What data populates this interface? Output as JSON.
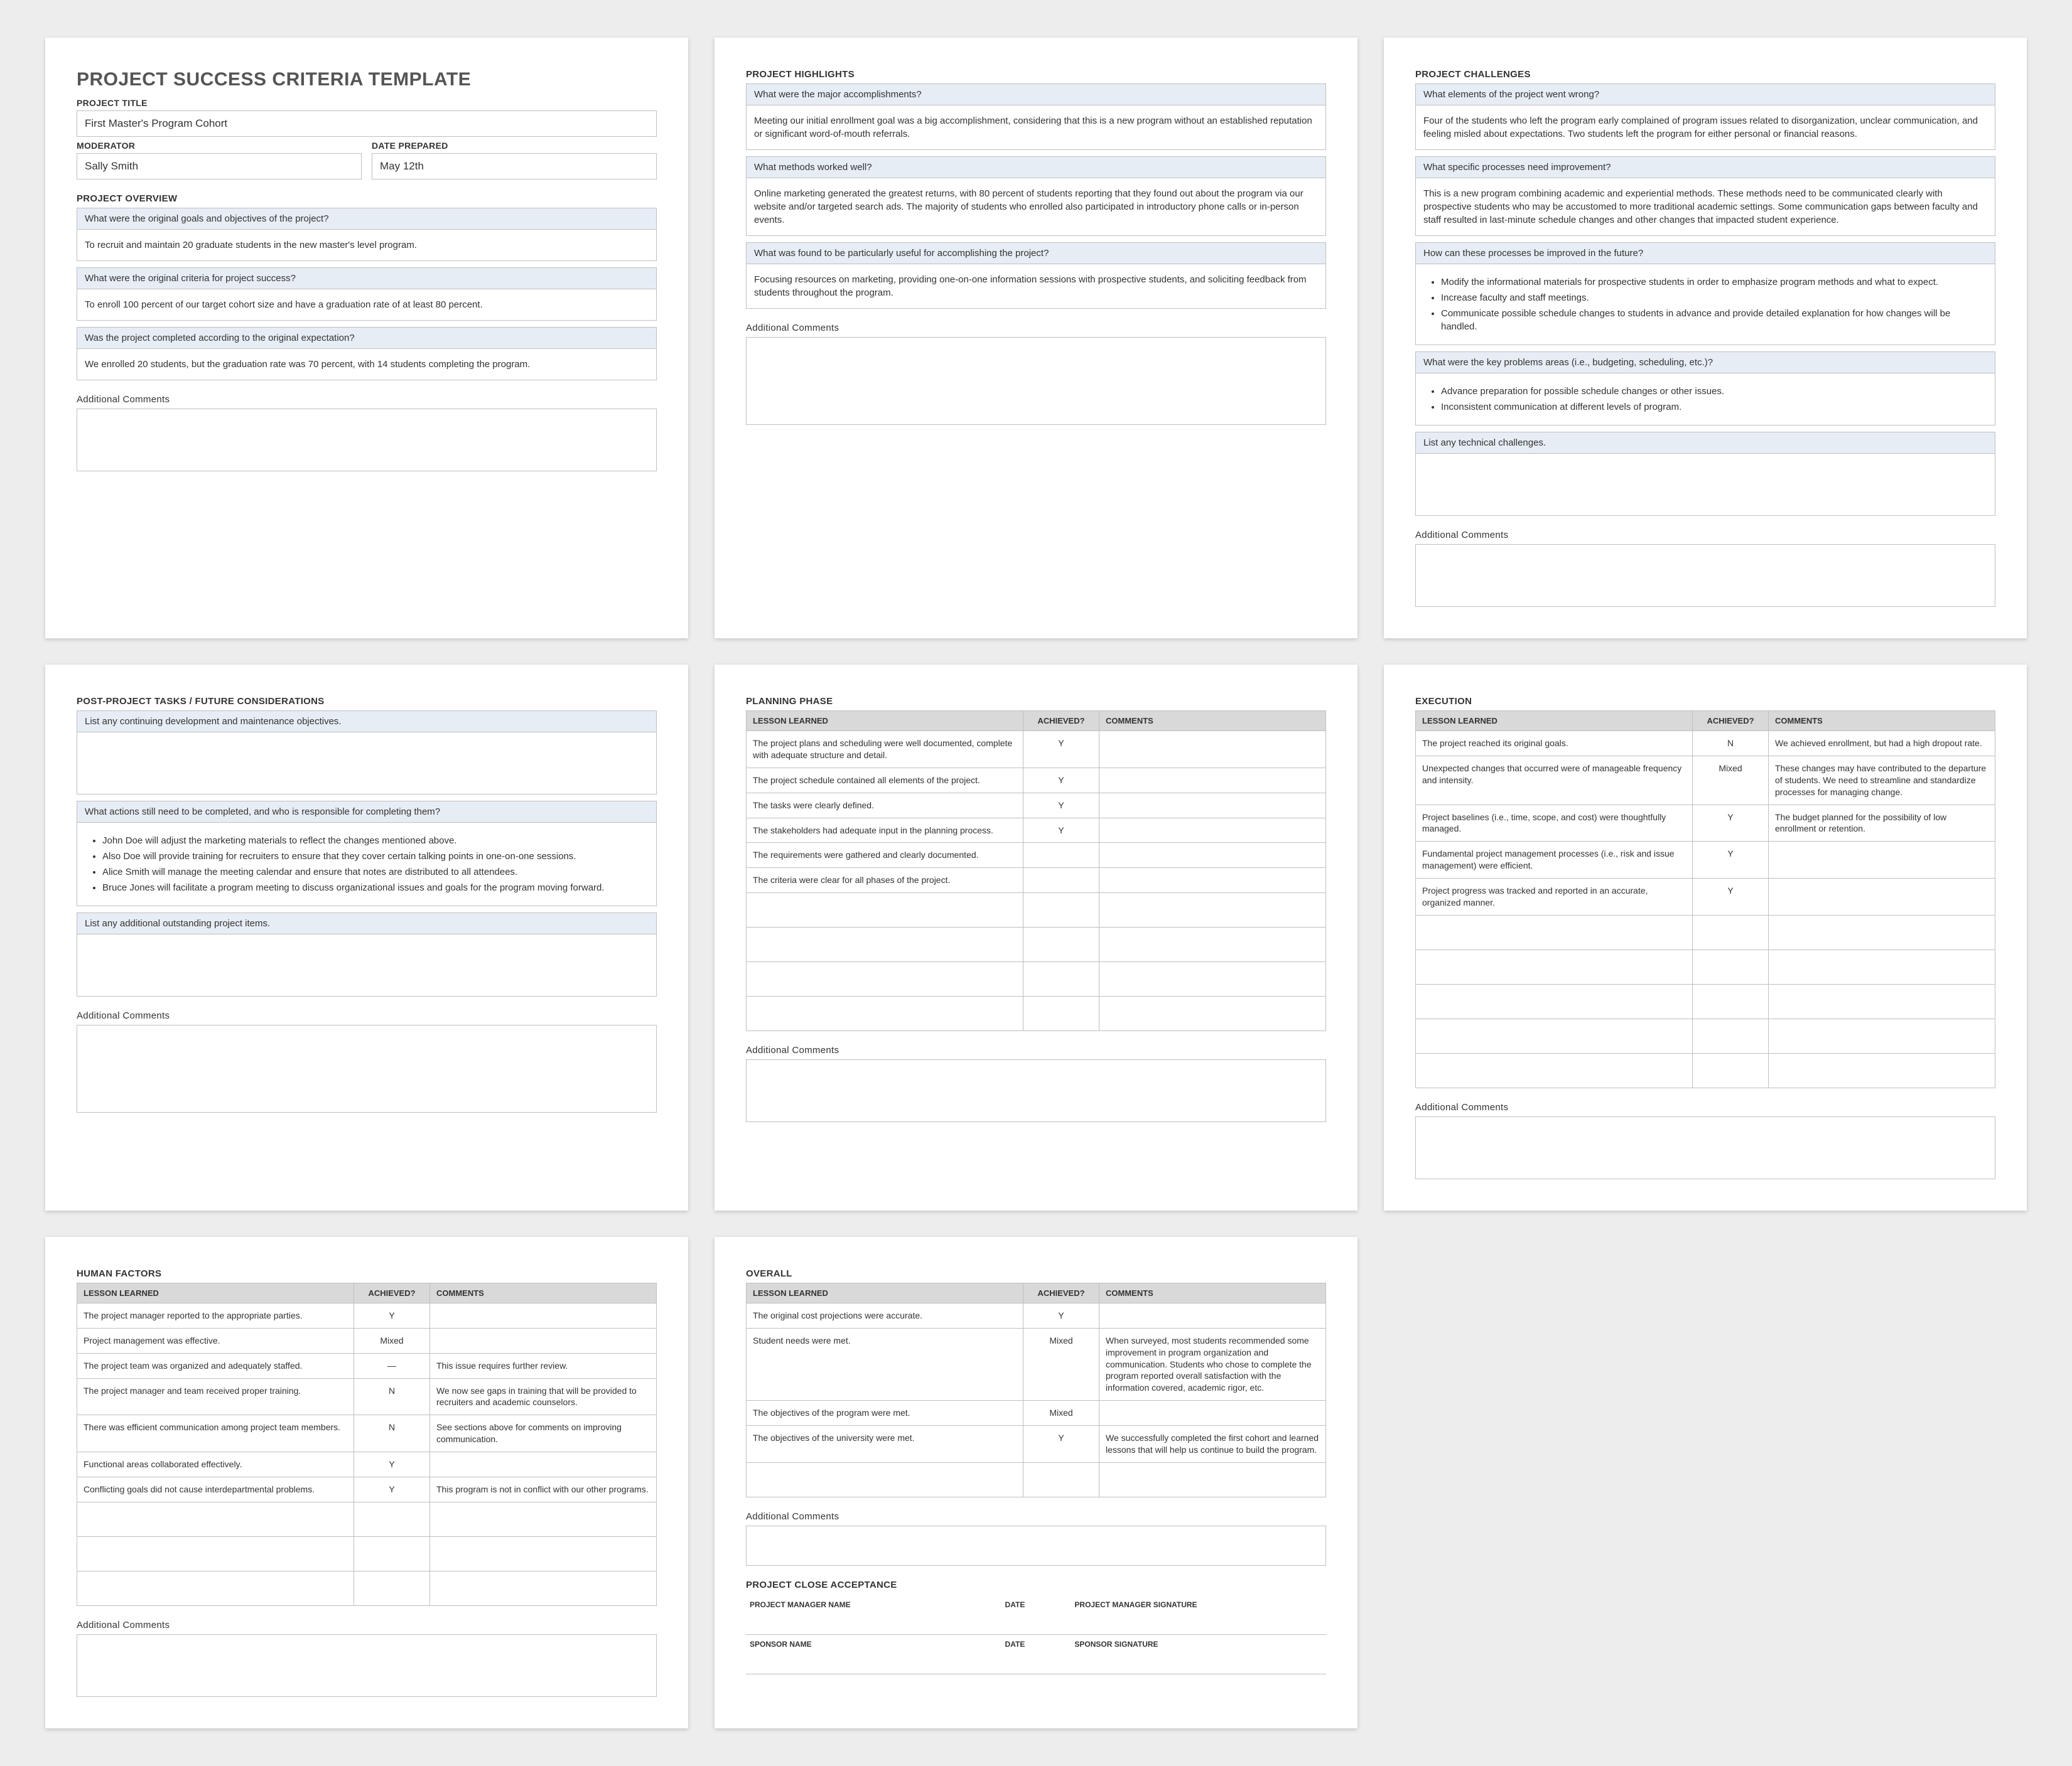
{
  "template_title": "PROJECT SUCCESS CRITERIA TEMPLATE",
  "labels": {
    "project_title": "PROJECT TITLE",
    "moderator": "MODERATOR",
    "date_prepared": "DATE PREPARED",
    "project_overview": "PROJECT OVERVIEW",
    "additional_comments": "Additional Comments",
    "project_highlights": "PROJECT HIGHLIGHTS",
    "project_challenges": "PROJECT CHALLENGES",
    "post_project": "POST-PROJECT TASKS / FUTURE CONSIDERATIONS",
    "planning_phase": "PLANNING PHASE",
    "execution": "EXECUTION",
    "human_factors": "HUMAN FACTORS",
    "overall": "OVERALL",
    "lesson_learned": "LESSON LEARNED",
    "achieved": "ACHIEVED?",
    "comments": "COMMENTS",
    "project_close": "PROJECT CLOSE ACCEPTANCE",
    "pm_name": "PROJECT MANAGER NAME",
    "date": "DATE",
    "pm_sig": "PROJECT MANAGER SIGNATURE",
    "sponsor_name": "SPONSOR NAME",
    "sponsor_sig": "SPONSOR SIGNATURE"
  },
  "header": {
    "project_title": "First Master's Program Cohort",
    "moderator": "Sally Smith",
    "date_prepared": "May 12th"
  },
  "overview": {
    "q1": "What were the original goals and objectives of the project?",
    "a1": "To recruit and maintain 20 graduate students in the new master's level program.",
    "q2": "What were the original criteria for project success?",
    "a2": "To enroll 100 percent of our target cohort size and have a graduation rate of at least 80 percent.",
    "q3": "Was the project completed according to the original expectation?",
    "a3": "We enrolled 20 students, but the graduation rate was 70 percent, with 14 students completing the program."
  },
  "highlights": {
    "q1": "What were the major accomplishments?",
    "a1": "Meeting our initial enrollment goal was a big accomplishment, considering that this is a new program without an established reputation or significant word-of-mouth referrals.",
    "q2": "What methods worked well?",
    "a2": "Online marketing generated the greatest returns, with 80 percent of students reporting that they found out about the program via our website and/or targeted search ads. The majority of students who enrolled also participated in introductory phone calls or in-person events.",
    "q3": "What was found to be particularly useful for accomplishing the project?",
    "a3": "Focusing resources on marketing, providing one-on-one information sessions with prospective students, and soliciting feedback from students throughout the program."
  },
  "challenges": {
    "q1": "What elements of the project went wrong?",
    "a1": "Four of the students who left the program early complained of program issues related to disorganization, unclear communication, and feeling misled about expectations. Two students left the program for either personal or financial reasons.",
    "q2": "What specific processes need improvement?",
    "a2": "This is a new program combining academic and experiential methods. These methods need to be communicated clearly with prospective students who may be accustomed to more traditional academic settings. Some communication gaps between faculty and staff resulted in last-minute schedule changes and other changes that impacted student experience.",
    "q3": "How can these processes be improved in the future?",
    "a3": [
      "Modify the informational materials for prospective students in order to emphasize program methods and what to expect.",
      "Increase faculty and staff meetings.",
      "Communicate possible schedule changes to students in advance and provide detailed explanation for how changes will be handled."
    ],
    "q4": "What were the key problems areas (i.e., budgeting, scheduling, etc.)?",
    "a4": [
      "Advance preparation for possible schedule changes or other issues.",
      "Inconsistent communication at different levels of program."
    ],
    "q5": "List any technical challenges."
  },
  "post_project": {
    "q1": "List any continuing development and maintenance objectives.",
    "q2": "What actions still need to be completed, and who is responsible for completing them?",
    "a2": [
      "John Doe will adjust the marketing materials to reflect the changes mentioned above.",
      "Also Doe will provide training for recruiters to ensure that they cover certain talking points in one-on-one sessions.",
      "Alice Smith will manage the meeting calendar and ensure that notes are distributed to all attendees.",
      "Bruce Jones will facilitate a program meeting to discuss organizational issues and goals for the program moving forward."
    ],
    "q3": "List any additional outstanding project items."
  },
  "planning": [
    {
      "l": "The project plans and scheduling were well documented, complete with adequate structure and detail.",
      "a": "Y",
      "c": ""
    },
    {
      "l": "The project schedule contained all elements of the project.",
      "a": "Y",
      "c": ""
    },
    {
      "l": "The tasks were clearly defined.",
      "a": "Y",
      "c": ""
    },
    {
      "l": "The stakeholders had adequate input in the planning process.",
      "a": "Y",
      "c": ""
    },
    {
      "l": "The requirements were gathered and clearly documented.",
      "a": "",
      "c": ""
    },
    {
      "l": "The criteria were clear for all phases of the project.",
      "a": "",
      "c": ""
    }
  ],
  "execution": [
    {
      "l": "The project reached its original goals.",
      "a": "N",
      "c": "We achieved enrollment, but had a high dropout rate."
    },
    {
      "l": "Unexpected changes that occurred were of manageable frequency and intensity.",
      "a": "Mixed",
      "c": "These changes may have contributed to the departure of students. We need to streamline and standardize processes for managing change."
    },
    {
      "l": "Project baselines (i.e., time, scope, and cost) were thoughtfully managed.",
      "a": "Y",
      "c": "The budget planned for the possibility of low enrollment or retention."
    },
    {
      "l": "Fundamental project management processes (i.e., risk and issue management) were efficient.",
      "a": "Y",
      "c": ""
    },
    {
      "l": "Project progress was tracked and reported in an accurate, organized manner.",
      "a": "Y",
      "c": ""
    }
  ],
  "human": [
    {
      "l": "The project manager reported to the appropriate parties.",
      "a": "Y",
      "c": ""
    },
    {
      "l": "Project management was effective.",
      "a": "Mixed",
      "c": ""
    },
    {
      "l": "The project team was organized and adequately staffed.",
      "a": "—",
      "c": "This issue requires further review."
    },
    {
      "l": "The project manager and team received proper training.",
      "a": "N",
      "c": "We now see gaps in training that will be provided to recruiters and academic counselors."
    },
    {
      "l": "There was efficient communication among project team members.",
      "a": "N",
      "c": "See sections above for comments on improving communication."
    },
    {
      "l": "Functional areas collaborated effectively.",
      "a": "Y",
      "c": ""
    },
    {
      "l": "Conflicting goals did not cause interdepartmental problems.",
      "a": "Y",
      "c": "This program is not in conflict with our other programs."
    }
  ],
  "overall": [
    {
      "l": "The original cost projections were accurate.",
      "a": "Y",
      "c": ""
    },
    {
      "l": "Student needs were met.",
      "a": "Mixed",
      "c": "When surveyed, most students recommended some improvement in program organization and communication. Students who chose to complete the program reported overall satisfaction with the information covered, academic rigor, etc."
    },
    {
      "l": "The objectives of the program were met.",
      "a": "Mixed",
      "c": ""
    },
    {
      "l": "The objectives of the university were met.",
      "a": "Y",
      "c": "We successfully completed the first cohort and learned lessons that will help us continue to build the program."
    }
  ]
}
